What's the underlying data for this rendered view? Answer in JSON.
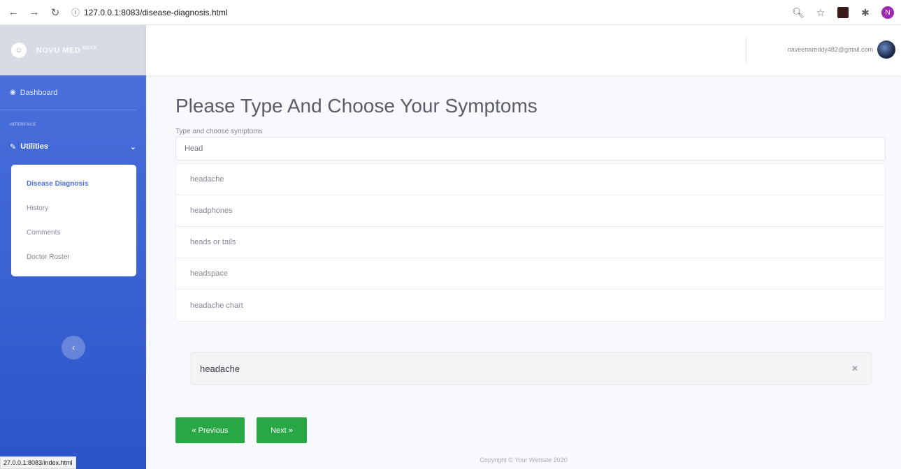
{
  "browser": {
    "url": "127.0.0.1:8083/disease-diagnosis.html",
    "status_url": "27.0.0.1:8083/index.html",
    "profile_initial": "N"
  },
  "sidebar": {
    "brand": "NOVU MED",
    "brand_badge": "BETA",
    "dashboard_label": "Dashboard",
    "section_heading": "INTERFACE",
    "utilities_label": "Utilities",
    "submenu": [
      {
        "label": "Disease Diagnosis",
        "active": true
      },
      {
        "label": "History",
        "active": false
      },
      {
        "label": "Comments",
        "active": false
      },
      {
        "label": "Doctor Roster",
        "active": false
      }
    ]
  },
  "topbar": {
    "user_email": "naveenareddy482@gmail.com"
  },
  "main": {
    "title": "Please Type And Choose Your Symptoms",
    "field_label": "Type and choose symptoms",
    "search_value": "Head",
    "suggestions": [
      "headache",
      "headphones",
      "heads or tails",
      "headspace",
      "headache chart"
    ],
    "selected_symptom": "headache",
    "prev_button": "« Previous",
    "next_button": "Next »"
  },
  "footer": {
    "text": "Copyright © Your Website 2020"
  },
  "colors": {
    "sidebar_primary": "#4e73df",
    "button_green": "#28a745",
    "profile": "#9c27b0"
  }
}
